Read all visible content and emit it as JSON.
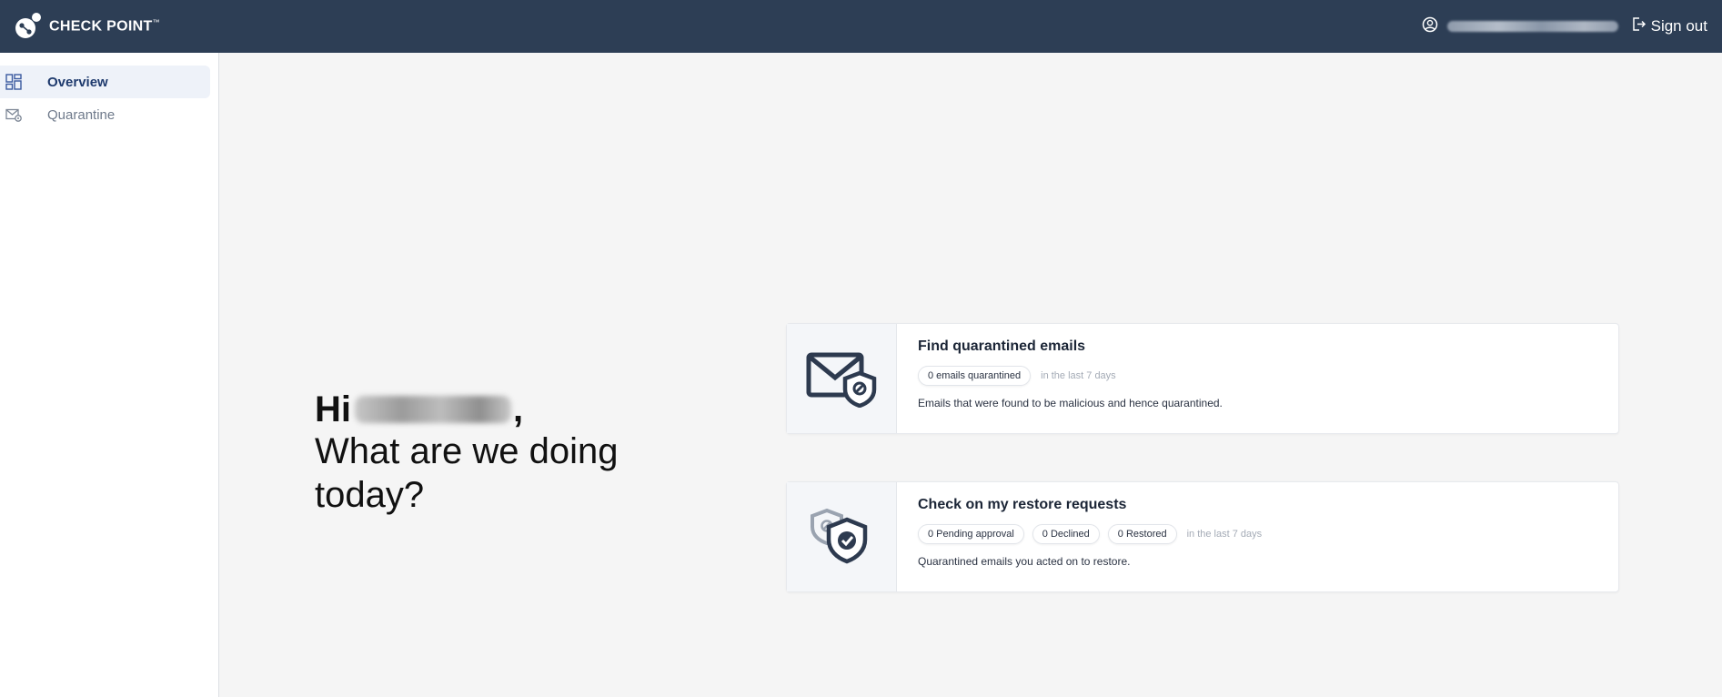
{
  "header": {
    "brand_name": "CHECK POINT",
    "brand_mark": "™",
    "user_icon": "user-circle-icon",
    "signout_label": "Sign out",
    "signout_icon": "sign-out-icon",
    "bg_color": "#2d3e55"
  },
  "sidebar": {
    "items": [
      {
        "label": "Overview",
        "icon": "dashboard-icon",
        "active": true
      },
      {
        "label": "Quarantine",
        "icon": "mail-settings-icon",
        "active": false
      }
    ]
  },
  "greeting": {
    "hi": "Hi",
    "comma": ",",
    "question": "What are we doing today?"
  },
  "cards": [
    {
      "title": "Find quarantined emails",
      "icon": "mail-shield-icon",
      "pills": [
        "0 emails quarantined"
      ],
      "period": "in the last 7 days",
      "description": "Emails that were found to be malicious and hence quarantined."
    },
    {
      "title": "Check on my restore requests",
      "icon": "shield-check-icon",
      "pills": [
        "0 Pending approval",
        "0 Declined",
        "0 Restored"
      ],
      "period": "in the last 7 days",
      "description": "Quarantined emails you acted on to restore."
    }
  ]
}
